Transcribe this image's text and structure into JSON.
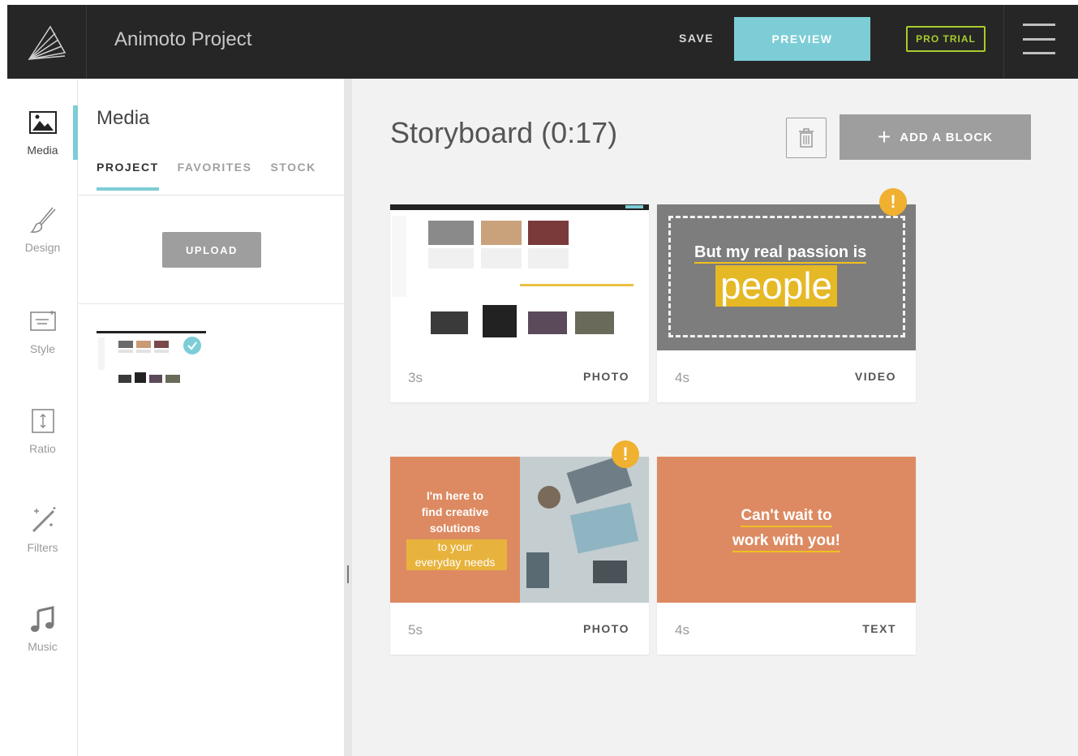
{
  "header": {
    "project_title": "Animoto Project",
    "save_label": "SAVE",
    "preview_label": "PREVIEW",
    "pro_trial_label": "PRO TRIAL",
    "logo_icon": "animoto-logo-icon",
    "menu_icon": "hamburger-menu-icon",
    "accent_color": "#7ccdd6",
    "pro_color": "#a8cc2c"
  },
  "nav": {
    "items": [
      {
        "label": "Media",
        "icon": "image-icon",
        "active": true
      },
      {
        "label": "Design",
        "icon": "brush-icon",
        "active": false
      },
      {
        "label": "Style",
        "icon": "text-style-icon",
        "active": false
      },
      {
        "label": "Ratio",
        "icon": "aspect-ratio-icon",
        "active": false
      },
      {
        "label": "Filters",
        "icon": "magic-wand-icon",
        "active": false
      },
      {
        "label": "Music",
        "icon": "music-note-icon",
        "active": false
      }
    ]
  },
  "media_panel": {
    "title": "Media",
    "tabs": [
      {
        "label": "PROJECT",
        "active": true
      },
      {
        "label": "FAVORITES",
        "active": false
      },
      {
        "label": "STOCK",
        "active": false
      }
    ],
    "upload_label": "UPLOAD"
  },
  "storyboard": {
    "title": "Storyboard (0:17)",
    "add_block_label": "ADD A BLOCK",
    "cards": [
      {
        "duration": "3s",
        "type": "PHOTO",
        "warning": false
      },
      {
        "duration": "4s",
        "type": "VIDEO",
        "warning": true,
        "text_line1": "But my real passion is",
        "text_line2": "people"
      },
      {
        "duration": "5s",
        "type": "PHOTO",
        "warning": true,
        "text_lines": [
          "I'm here to",
          "find creative",
          "solutions"
        ],
        "highlight_lines": [
          "to your",
          "everyday needs"
        ]
      },
      {
        "duration": "4s",
        "type": "TEXT",
        "warning": false,
        "text_lines": [
          "Can't wait to",
          "work with you!"
        ]
      }
    ]
  }
}
